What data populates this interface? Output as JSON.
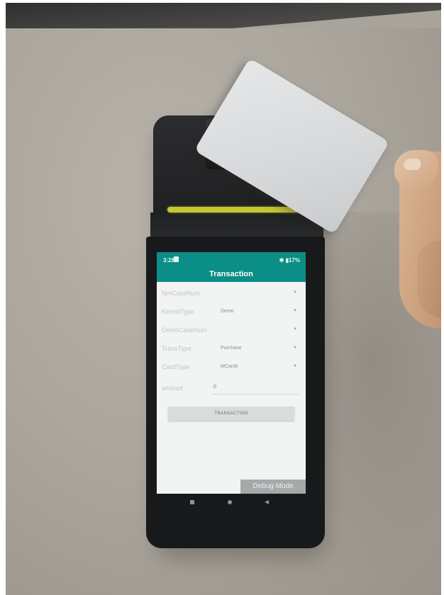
{
  "status_bar": {
    "time": "3:28",
    "indicators": "✱ ▮17%"
  },
  "app_bar": {
    "title": "Transaction"
  },
  "form": {
    "rows": [
      {
        "label": "NmCaseNum",
        "value": ""
      },
      {
        "label": "KernelType",
        "value": "Demo"
      },
      {
        "label": "DemoCaseNum",
        "value": ""
      },
      {
        "label": "TransType",
        "value": "Purchase"
      },
      {
        "label": "CardType",
        "value": "MCards"
      }
    ],
    "amount": {
      "label": "amount",
      "value": "0"
    },
    "arrow": "▼"
  },
  "buttons": {
    "transaction_label": "TRANSACTION"
  },
  "debug_badge": "Debug Mode",
  "nav": {
    "back": "◀"
  },
  "colors": {
    "accent": "#0a8e86",
    "paper_slot": "#c4c734"
  }
}
